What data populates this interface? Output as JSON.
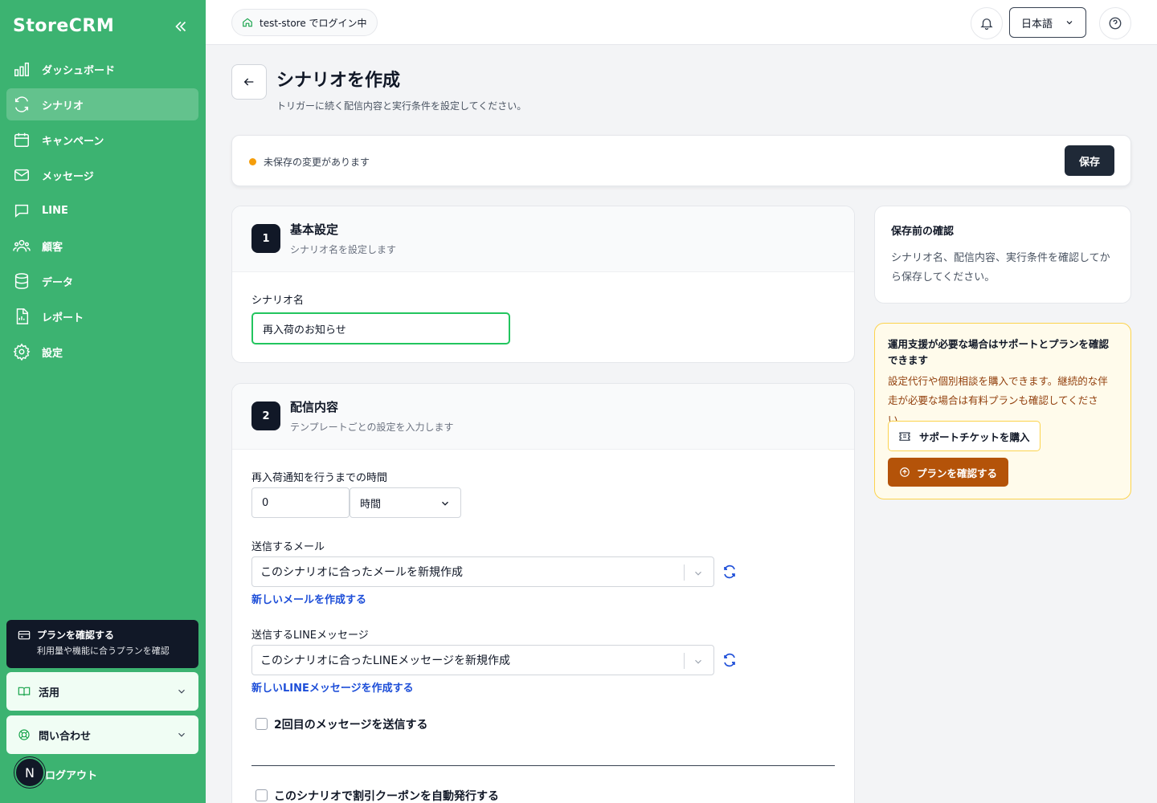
{
  "app": {
    "brand": "StoreCRM"
  },
  "sidebar": {
    "items": [
      {
        "label": "ダッシュボード",
        "icon": "bar-chart-icon"
      },
      {
        "label": "シナリオ",
        "icon": "refresh-icon"
      },
      {
        "label": "キャンペーン",
        "icon": "calendar-icon"
      },
      {
        "label": "メッセージ",
        "icon": "mail-icon"
      },
      {
        "label": "LINE",
        "icon": "chat-icon"
      },
      {
        "label": "顧客",
        "icon": "users-icon"
      },
      {
        "label": "データ",
        "icon": "database-icon"
      },
      {
        "label": "レポート",
        "icon": "report-icon"
      },
      {
        "label": "設定",
        "icon": "gear-icon"
      }
    ],
    "active_index": 1,
    "plan_card": {
      "title": "プランを確認する",
      "subtitle": "利用量や機能に合うプランを確認"
    },
    "accordion": [
      {
        "label": "活用"
      },
      {
        "label": "問い合わせ"
      }
    ],
    "avatar_initial": "N",
    "logout": "ログアウト"
  },
  "topbar": {
    "store_status": "test-store でログイン中",
    "language": "日本語"
  },
  "page": {
    "title": "シナリオを作成",
    "subtitle": "トリガーに続く配信内容と実行条件を設定してください。",
    "unsaved_text": "未保存の変更があります",
    "save_label": "保存"
  },
  "section1": {
    "step": "1",
    "title": "基本設定",
    "subtitle": "シナリオ名を設定します",
    "name_label": "シナリオ名",
    "name_value": "再入荷のお知らせ"
  },
  "section2": {
    "step": "2",
    "title": "配信内容",
    "subtitle": "テンプレートごとの設定を入力します",
    "delay_label": "再入荷通知を行うまでの時間",
    "delay_value": "0",
    "delay_unit": "時間",
    "mail_label": "送信するメール",
    "mail_value": "このシナリオに合ったメールを新規作成",
    "mail_link": "新しいメールを作成する",
    "line_label": "送信するLINEメッセージ",
    "line_value": "このシナリオに合ったLINEメッセージを新規作成",
    "line_link": "新しいLINEメッセージを作成する",
    "second_message_label": "2回目のメッセージを送信する",
    "coupon_label": "このシナリオで割引クーポンを自動発行する"
  },
  "right": {
    "confirm_title": "保存前の確認",
    "confirm_body": "シナリオ名、配信内容、実行条件を確認してから保存してください。",
    "support_title": "運用支援が必要な場合はサポートとプランを確認できます",
    "support_body": "設定代行や個別相談を購入できます。継続的な伴走が必要な場合は有料プランも確認してください。",
    "ticket_button": "サポートチケットを購入",
    "plan_button": "プランを確認する"
  }
}
